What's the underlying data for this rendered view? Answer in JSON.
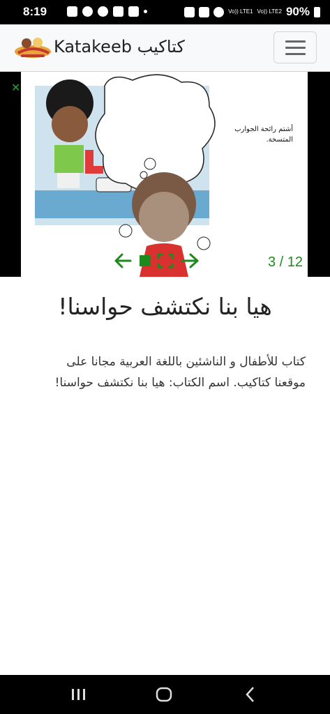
{
  "status_bar": {
    "time": "8:19",
    "sim1": "Vo)) LTE1",
    "sim2": "Vo)) LTE2",
    "battery": "90%"
  },
  "navbar": {
    "brand": "Katakeeb كتاكيب",
    "logo_icon": "katakeeb-logo"
  },
  "viewer": {
    "page_text": "أشتم رائحة الجوارب المتسخة.",
    "counter": "3 / 12",
    "accent": "#1e8a1e"
  },
  "content": {
    "title": "هيا بنا نكتشف حواسنا!",
    "description": "كتاب للأطفال و الناشئين باللغة العربية مجانا على موقعنا كتاكيب. اسم الكتاب: هيا بنا نكتشف حواسنا!"
  }
}
